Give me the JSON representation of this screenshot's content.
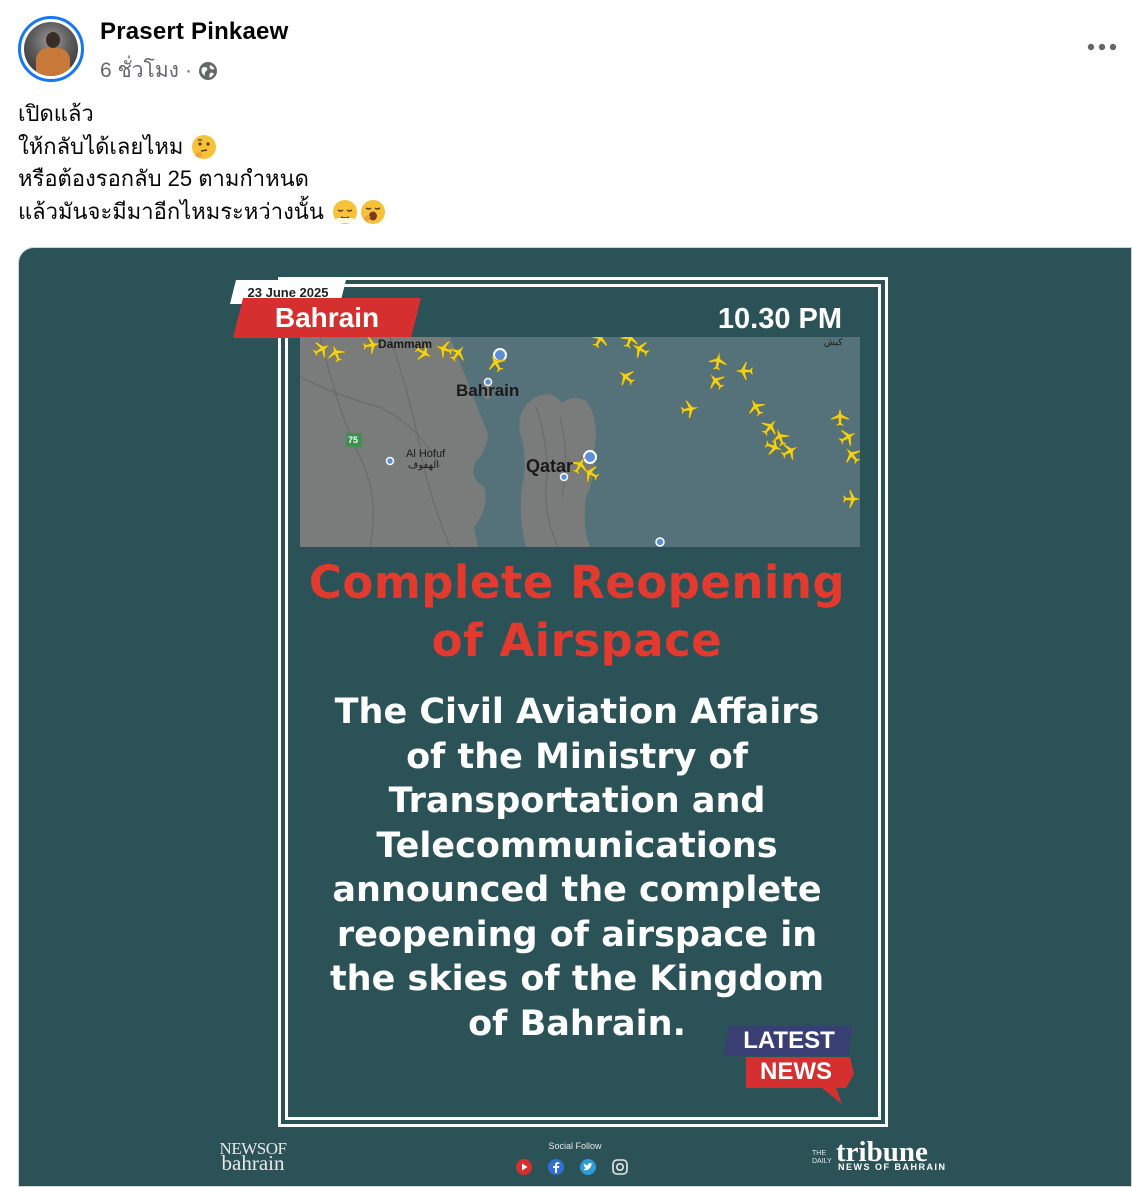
{
  "post": {
    "author": "Prasert Pinkaew",
    "time": "6 ชั่วโมง",
    "separator": "·",
    "privacy_icon": "globe-icon",
    "more_icon": "more-options-icon",
    "lines": [
      "เปิดแล้ว",
      "ให้กลับได้เลยไหม",
      "หรือต้องรอกลับ 25 ตามกำหนด",
      "แล้วมันจะมีมาอีกไหมระหว่างนั้น"
    ],
    "emojis": [
      "thinking-face-emoji",
      "relieved-face-emoji",
      "yawning-face-emoji"
    ]
  },
  "image": {
    "date": "23 June 2025",
    "location": "Bahrain",
    "time": "10.30 PM",
    "map": {
      "labels": {
        "dammam": "Dammam",
        "bahrain": "Bahrain",
        "al_hofuf": "Al Hofuf",
        "al_hofuf_arabic": "الهفوف",
        "qatar": "Qatar",
        "road": "75",
        "corner": "كيش"
      },
      "icon": "flight-tracker-map"
    },
    "headline": [
      "Complete Reopening",
      "of Airspace"
    ],
    "body": [
      "The Civil Aviation Affairs",
      "of the Ministry of",
      "Transportation and",
      "Telecommunications",
      "announced the complete",
      "reopening of airspace in",
      "the skies of the Kingdom",
      "of Bahrain."
    ],
    "badge": {
      "top": "LATEST",
      "bottom": "NEWS"
    },
    "footer": {
      "left_logo_line1": "NEWSOF",
      "left_logo_line2": "bahrain",
      "social_label": "Social Follow",
      "social_icons": [
        "youtube-icon",
        "facebook-icon",
        "twitter-icon",
        "instagram-icon"
      ],
      "right_logo_small": "THE DAILY",
      "right_logo": "tribune",
      "right_logo_sub": "NEWS OF BAHRAIN"
    }
  },
  "colors": {
    "card_background": "#2b5257",
    "headline_red": "#e23a2e",
    "tag_red": "#d62f2f",
    "badge_navy": "#3a3f73",
    "plane_yellow": "#f2d11c",
    "facebook_blue": "#1877f2"
  }
}
